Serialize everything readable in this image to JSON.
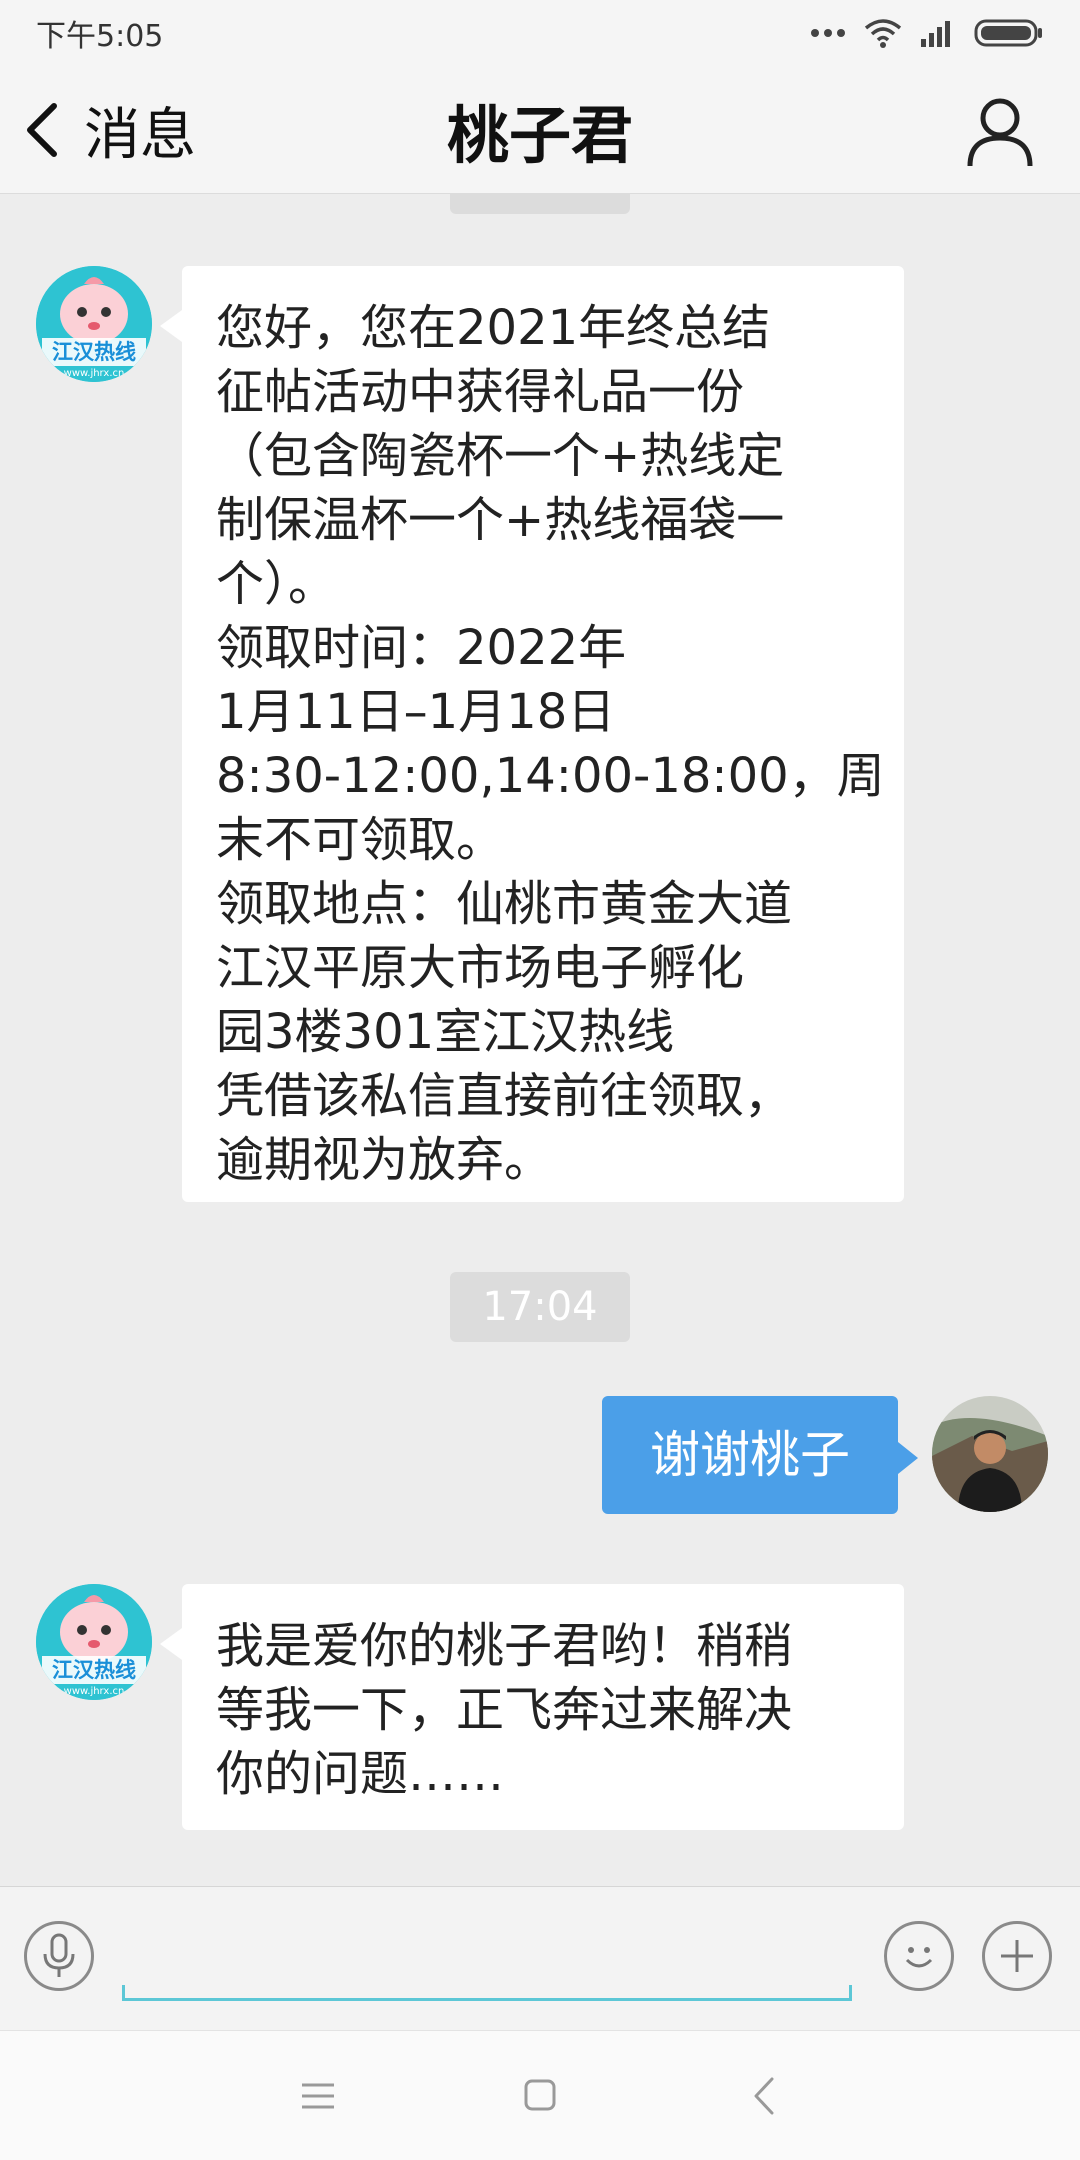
{
  "status_bar": {
    "time": "下午5:05",
    "signal_icons": "··· ",
    "battery_label": ""
  },
  "nav": {
    "back_label": "消息",
    "title": "桃子君"
  },
  "chat": {
    "messages": [
      {
        "from": "bot",
        "lines": [
          "您好，您在2021年终总结",
          "征帖活动中获得礼品一份",
          "（包含陶瓷杯一个+热线定",
          "制保温杯一个+热线福袋一",
          "个）。",
          "领取时间：2022年",
          "1月11日–1月18日",
          "8:30-12:00,14:00-18:00，周",
          "末不可领取。",
          "领取地点：仙桃市黄金大道",
          "江汉平原大市场电子孵化",
          "园3楼301室江汉热线",
          "凭借该私信直接前往领取，",
          "逾期视为放弃。"
        ]
      },
      {
        "from": "user",
        "text": "谢谢桃子"
      },
      {
        "from": "bot",
        "lines": [
          "我是爱你的桃子君哟！稍稍",
          "等我一下，正飞奔过来解决",
          "你的问题……"
        ]
      }
    ],
    "timestamp": "17:04",
    "bot_avatar_text": "江汉热线",
    "bot_avatar_url": "www.jhrx.cn"
  },
  "input": {
    "value": ""
  },
  "colors": {
    "user_bubble": "#4b9fe8",
    "bot_bubble": "#ffffff",
    "background": "#ededed",
    "input_underline": "#5cc7d6"
  },
  "icons": {
    "back": "chevron-left-icon",
    "profile": "person-icon",
    "voice": "microphone-icon",
    "emoji": "smiley-icon",
    "more": "plus-icon",
    "menu": "menu-icon",
    "home": "square-icon",
    "system_back": "chevron-left-icon"
  }
}
